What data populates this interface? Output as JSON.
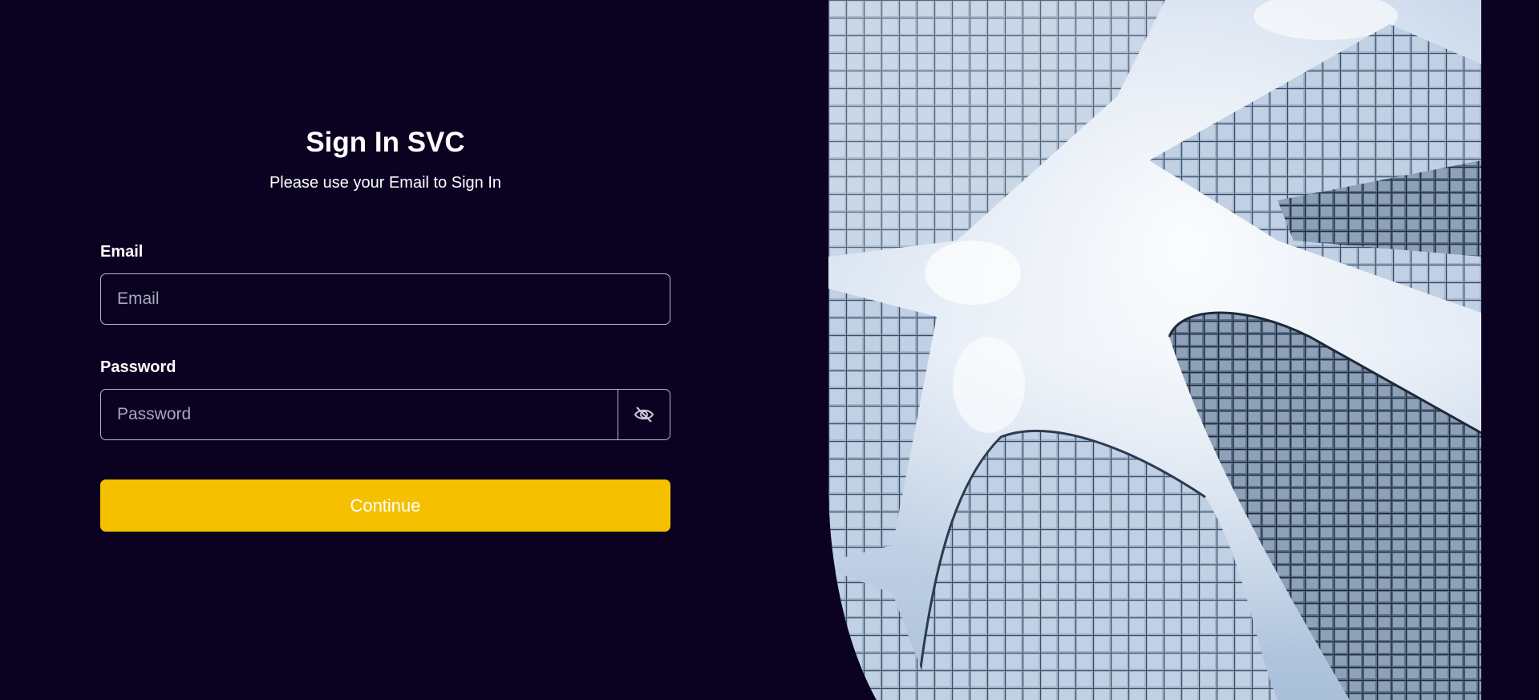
{
  "form": {
    "title": "Sign In SVC",
    "subtitle": "Please use your Email to Sign In",
    "email_label": "Email",
    "email_placeholder": "Email",
    "email_value": "",
    "password_label": "Password",
    "password_placeholder": "Password",
    "password_value": "",
    "toggle_icon": "eye-off-icon",
    "continue_label": "Continue"
  },
  "hero": {
    "image_subject": "glass-skyscrapers-looking-up"
  },
  "colors": {
    "background": "#0b0222",
    "accent": "#f5c000",
    "border": "#b9b5c9",
    "text": "#ffffff",
    "placeholder": "#a6a7bc"
  }
}
